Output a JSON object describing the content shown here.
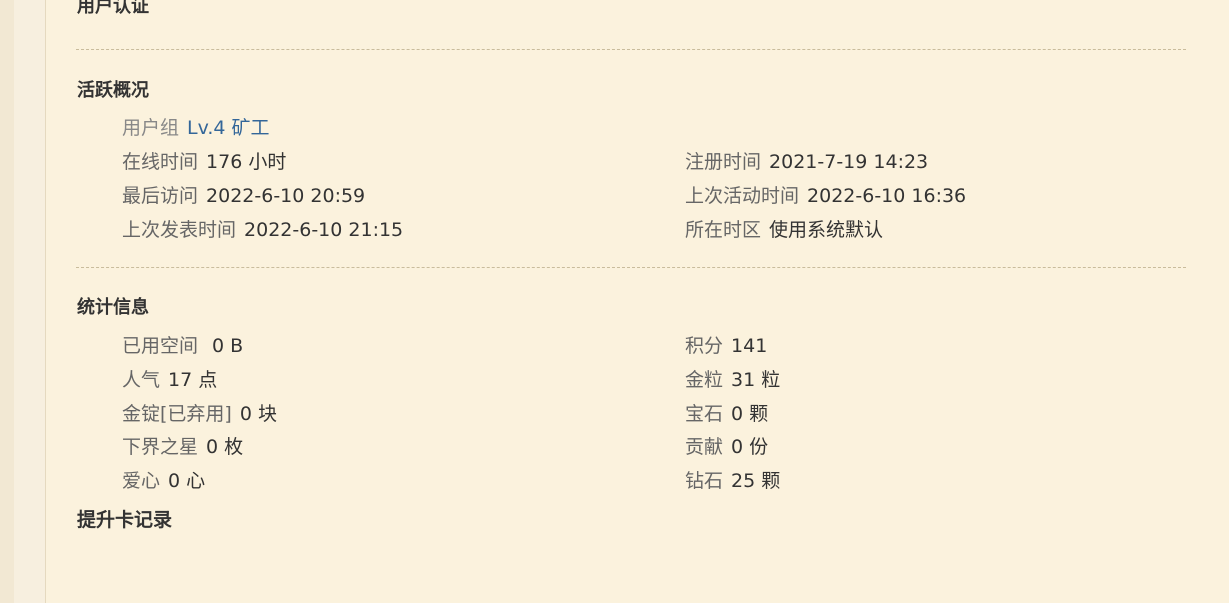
{
  "sections": {
    "auth_title": "用户认证",
    "activity_title": "活跃概况",
    "stats_title": "统计信息",
    "promo_title": "提升卡记录"
  },
  "activity": {
    "group_label": "用户组",
    "group_value": "Lv.4 矿工",
    "online_label": "在线时间",
    "online_value": "176 小时",
    "register_label": "注册时间",
    "register_value": "2021-7-19 14:23",
    "last_visit_label": "最后访问",
    "last_visit_value": "2022-6-10 20:59",
    "last_active_label": "上次活动时间",
    "last_active_value": "2022-6-10 16:36",
    "last_post_label": "上次发表时间",
    "last_post_value": "2022-6-10 21:15",
    "timezone_label": "所在时区",
    "timezone_value": "使用系统默认"
  },
  "stats": {
    "space_label": "已用空间",
    "space_value": " 0 B",
    "popularity_label": "人气",
    "popularity_value": "17 点",
    "ingot_label": "金锭[已弃用]",
    "ingot_value": "0 块",
    "nether_star_label": "下界之星",
    "nether_star_value": "0 枚",
    "love_label": "爱心",
    "love_value": "0 心",
    "points_label": "积分",
    "points_value": "141",
    "gold_label": "金粒",
    "gold_value": "31 粒",
    "gem_label": "宝石",
    "gem_value": "0 颗",
    "contribution_label": "贡献",
    "contribution_value": "0 份",
    "diamond_label": "钻石",
    "diamond_value": "25 颗"
  }
}
